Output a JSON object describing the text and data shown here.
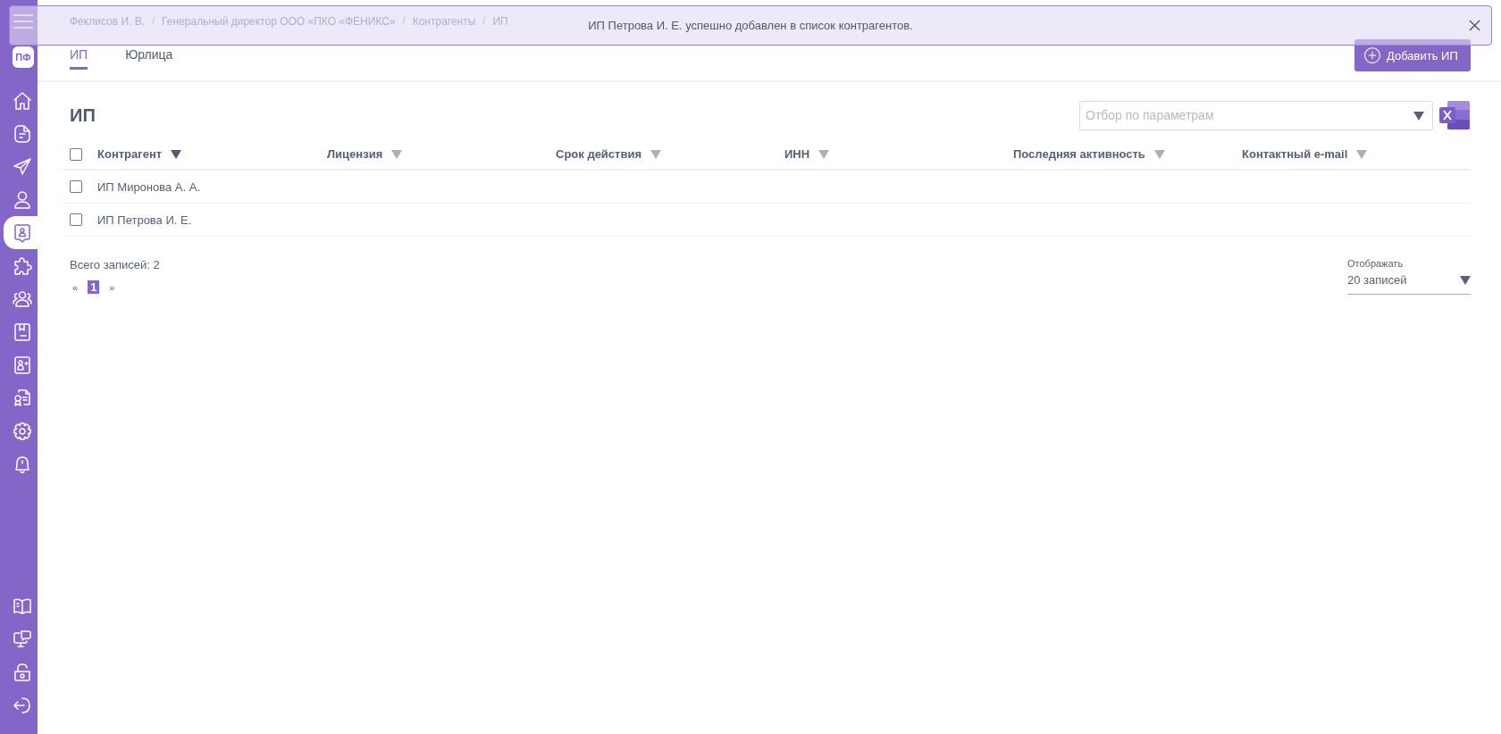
{
  "notification": {
    "message": "ИП Петрова И. Е. успешно добавлен в список контрагентов."
  },
  "sidebar": {
    "logo": "ПФ",
    "items": [
      {
        "selected": false
      },
      {
        "selected": false
      },
      {
        "selected": false
      },
      {
        "selected": false
      },
      {
        "selected": true
      },
      {
        "selected": false
      },
      {
        "selected": false
      },
      {
        "selected": false
      },
      {
        "selected": false
      },
      {
        "selected": false
      },
      {
        "selected": false
      },
      {
        "selected": false
      }
    ],
    "bottom_items": [
      {
        "selected": false
      },
      {
        "selected": false
      },
      {
        "selected": false
      },
      {
        "selected": false
      }
    ]
  },
  "breadcrumbs": [
    {
      "kind": "link",
      "text": "Феклисов И. В."
    },
    {
      "kind": "separator",
      "text": "/"
    },
    {
      "kind": "link",
      "text": "Генеральный директор ООО «ПКО «ФЕНИКС»"
    },
    {
      "kind": "separator",
      "text": "/"
    },
    {
      "kind": "link",
      "text": "Контрагенты"
    },
    {
      "kind": "separator",
      "text": "/"
    },
    {
      "kind": "link",
      "text": "ИП"
    }
  ],
  "tabs": [
    {
      "label": "ИП",
      "selected": true
    },
    {
      "label": "Юрлица",
      "selected": false
    }
  ],
  "add_button": "Добавить ИП",
  "page_title": "ИП",
  "filter": {
    "placeholder": "Отбор по параметрам"
  },
  "table": {
    "select_all_checked": false,
    "columns": [
      {
        "label": "Контрагент",
        "sorted": true
      },
      {
        "label": "Лицензия",
        "sorted": false
      },
      {
        "label": "Срок действия",
        "sorted": false
      },
      {
        "label": "ИНН",
        "sorted": false
      },
      {
        "label": "Последняя активность",
        "sorted": false
      },
      {
        "label": "Контактный e-mail",
        "sorted": false
      }
    ],
    "rows": [
      {
        "name": "ИП Миронова А. А.",
        "checked": false
      },
      {
        "name": "ИП Петрова И. Е.",
        "checked": false
      }
    ]
  },
  "total": "Всего записей: 2",
  "pagination": {
    "prev": "«",
    "pages": [
      {
        "label": "1",
        "selected": true
      }
    ],
    "next": "»"
  },
  "page_size": {
    "label": "Отображать",
    "value": "20 записей"
  }
}
